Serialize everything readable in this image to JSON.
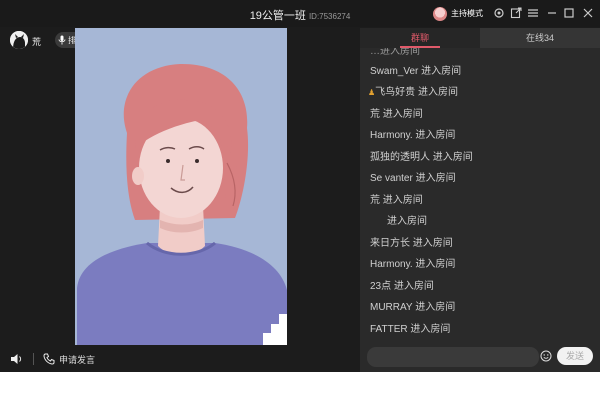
{
  "window": {
    "title": "19公管一班",
    "room_id": "ID:7536274",
    "host_mode_label": "主持模式"
  },
  "user": {
    "name": "荒",
    "badge_label": "排麦"
  },
  "footer": {
    "apply_speak_label": "申请发言"
  },
  "chat": {
    "tabs": [
      {
        "label": "群聊",
        "active": true
      },
      {
        "label": "在线34",
        "active": false
      }
    ],
    "partial_top": "…进入房间",
    "messages": [
      "Swam_Ver 进入房间",
      "飞鸟好贵 进入房间",
      "荒 进入房间",
      "Harmony. 进入房间",
      "孤独的透明人 进入房间",
      "Se vanter 进入房间",
      "荒 进入房间",
      "进入房间",
      "来日方长 进入房间",
      "Harmony. 进入房间",
      "23点 进入房间",
      "MURRAY 进入房间",
      "FATTER 进入房间"
    ],
    "send_label": "发送",
    "input_placeholder": ""
  },
  "colors": {
    "accent": "#e05a6a",
    "panel_bg": "#2a2a2a",
    "app_bg": "#1c1c1c",
    "video_bg": "#a6b7d6"
  }
}
